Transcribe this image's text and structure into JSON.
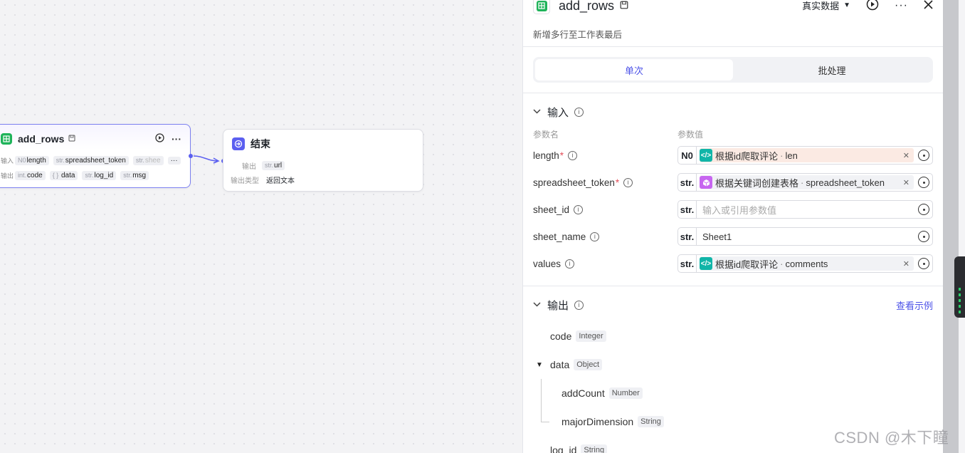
{
  "canvas": {
    "add_rows_node": {
      "title": "add_rows",
      "input_label": "输入",
      "output_label": "输出",
      "more": "···",
      "inputs": [
        {
          "type": "N0",
          "name": "length"
        },
        {
          "type": "str.",
          "name": "spreadsheet_token"
        },
        {
          "type": "str.",
          "name": "shee"
        }
      ],
      "outputs": [
        {
          "type": "int.",
          "name": "code"
        },
        {
          "type": "{ }",
          "name": "data"
        },
        {
          "type": "str.",
          "name": "log_id"
        },
        {
          "type": "str.",
          "name": "msg"
        }
      ]
    },
    "end_node": {
      "title": "结束",
      "output_label": "输出",
      "output_type_label": "输出类型",
      "output_var_type": "str.",
      "output_var": "url",
      "output_type_value": "返回文本"
    }
  },
  "panel": {
    "title": "add_rows",
    "description": "新增多行至工作表最后",
    "real_data": "真实数据",
    "tabs": [
      {
        "label": "单次"
      },
      {
        "label": "批处理"
      }
    ],
    "input_section": {
      "title": "输入",
      "col_name": "参数名",
      "col_value": "参数值",
      "params": [
        {
          "name": "length",
          "required": "*",
          "type": "N0",
          "ref_source": "根据id爬取评论",
          "ref_sep": "·",
          "ref_var": "len"
        },
        {
          "name": "spreadsheet_token",
          "required": "*",
          "type": "str.",
          "ref_source": "根据关键词创建表格",
          "ref_sep": "·",
          "ref_var": "spreadsheet_token"
        },
        {
          "name": "sheet_id",
          "type": "str.",
          "placeholder": "输入或引用参数值"
        },
        {
          "name": "sheet_name",
          "type": "str.",
          "value": "Sheet1"
        },
        {
          "name": "values",
          "type": "str.",
          "ref_source": "根据id爬取评论",
          "ref_sep": "·",
          "ref_var": "comments"
        }
      ]
    },
    "output_section": {
      "title": "输出",
      "view_example": "查看示例",
      "items": [
        {
          "name": "code",
          "type": "Integer"
        },
        {
          "name": "data",
          "type": "Object"
        },
        {
          "name": "addCount",
          "type": "Number"
        },
        {
          "name": "majorDimension",
          "type": "String"
        },
        {
          "name": "log_id",
          "type": "String"
        }
      ]
    }
  },
  "watermark": "CSDN @木下瞳",
  "colors": {
    "accent": "#4d53e8",
    "sheet_green": "#1fb35a",
    "end_purple": "#5b5ff0",
    "code_teal": "#11b5a8",
    "cube_purple": "#c766f0"
  }
}
